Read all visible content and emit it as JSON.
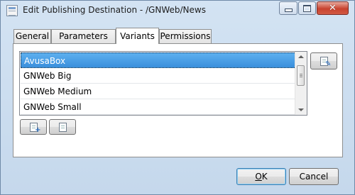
{
  "window": {
    "title": "Edit Publishing Destination - /GNWeb/News",
    "controls": {
      "minimize_icon": "minimize-icon",
      "maximize_icon": "maximize-icon",
      "close_glyph": "✕"
    }
  },
  "tabs": [
    {
      "label": "General",
      "active": false
    },
    {
      "label": "Parameters",
      "active": false
    },
    {
      "label": "Variants",
      "active": true
    },
    {
      "label": "Permissions",
      "active": false
    }
  ],
  "variants": {
    "items": [
      {
        "label": "AvusaBox",
        "selected": true
      },
      {
        "label": "GNWeb Big",
        "selected": false
      },
      {
        "label": "GNWeb Medium",
        "selected": false
      },
      {
        "label": "GNWeb Small",
        "selected": false
      }
    ],
    "actions": {
      "edit_icon": "edit-variant-icon",
      "add_icon": "add-variant-icon",
      "remove_icon": "remove-variant-icon"
    }
  },
  "footer": {
    "ok_mnemonic": "O",
    "ok_rest": "K",
    "cancel_label": "Cancel"
  },
  "colors": {
    "selection": "#3a8fdc",
    "window_frame": "#c5d8ec",
    "close_button": "#c7432f"
  }
}
